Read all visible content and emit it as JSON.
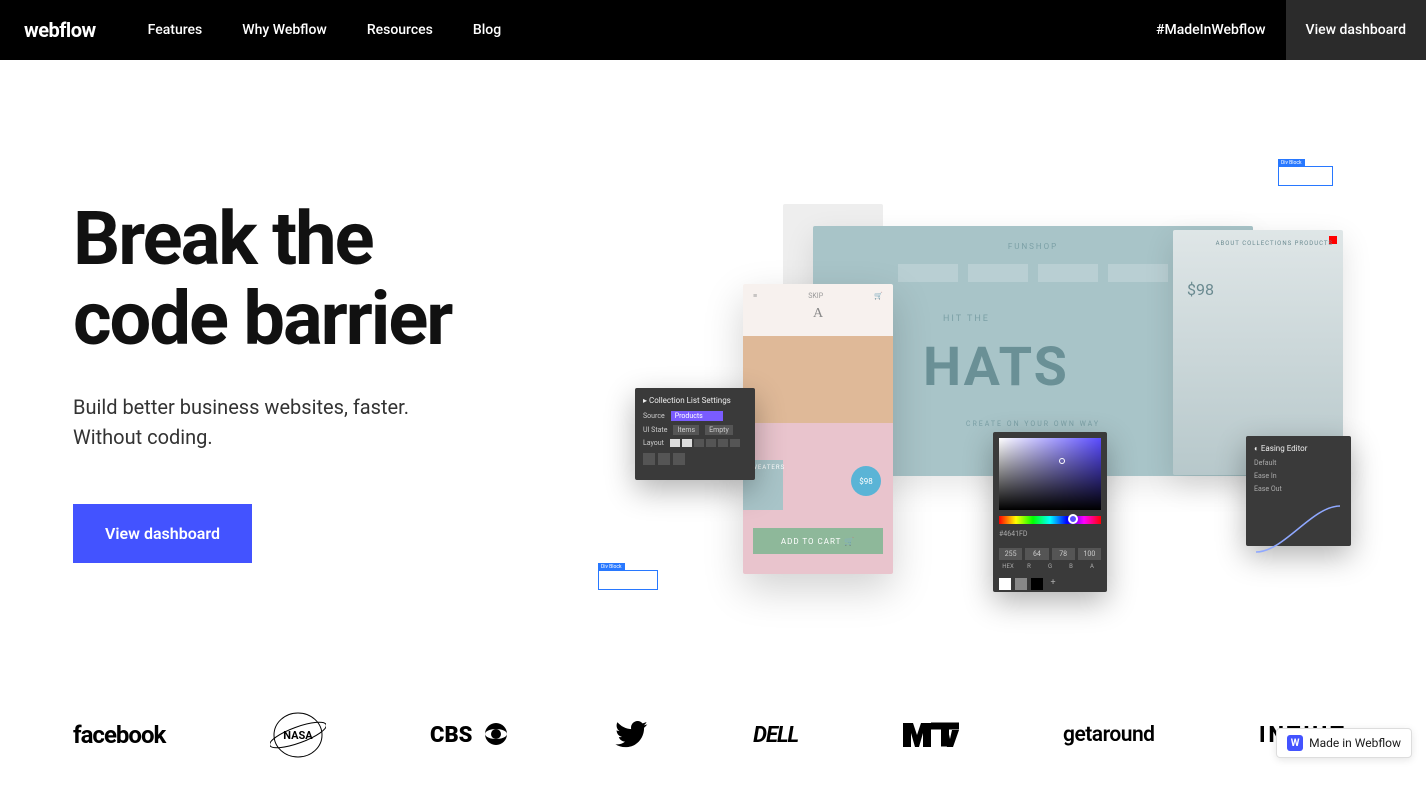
{
  "brand": "webflow",
  "nav": {
    "items": [
      "Features",
      "Why Webflow",
      "Resources",
      "Blog"
    ],
    "cta1": "#MadeInWebflow",
    "cta2": "View dashboard"
  },
  "hero": {
    "title_l1": "Break the",
    "title_l2": "code barrier",
    "sub_l1": "Build better business websites, faster.",
    "sub_l2": "Without coding.",
    "button": "View dashboard"
  },
  "mock": {
    "funshop": "FUNSHOP",
    "hit": "HIT THE",
    "hats": "HATS",
    "create": "CREATE ON YOUR OWN WAY",
    "man_nav": "ABOUT   COLLECTIONS   PRODUCTS",
    "man_price": "$98",
    "photo_skip": "SKIP",
    "sig": "A",
    "sweaters": "SWEATERS",
    "price": "$98",
    "addcart": "ADD TO CART 🛒",
    "divblock": "Div Block",
    "settings": {
      "title": "Collection List Settings",
      "source": "Source",
      "products": "Products",
      "uistate": "UI State",
      "items": "Items",
      "empty": "Empty",
      "layout": "Layout"
    },
    "color": {
      "r": "255",
      "g": "64",
      "b": "78",
      "a": "100",
      "rl": "R",
      "gl": "G",
      "bl": "B",
      "al": "A",
      "hex_label": "#4641FD",
      "hex": "HEX"
    },
    "ease": {
      "title": "Easing Editor",
      "default": "Default",
      "easein": "Ease In",
      "easeout": "Ease Out"
    }
  },
  "logos": {
    "facebook": "facebook",
    "nasa": "NASA",
    "cbs": "CBS",
    "dell": "DELL",
    "getaround": "getaround",
    "intuit": "INTUIT"
  },
  "badge": "Made in Webflow",
  "badge_w": "W"
}
